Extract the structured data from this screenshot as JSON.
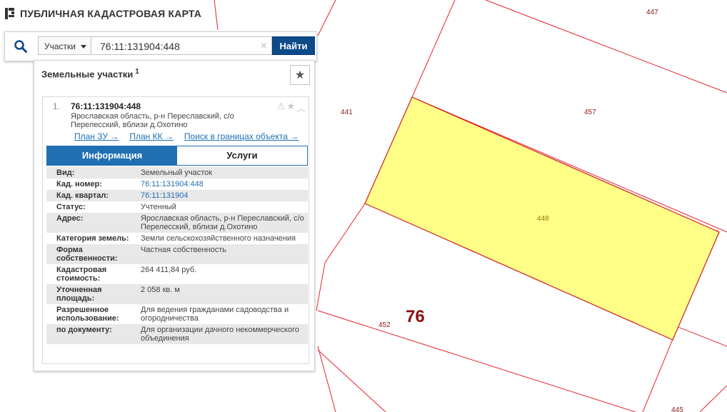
{
  "app": {
    "title": "ПУБЛИЧНАЯ КАДАСТРОВАЯ КАРТА"
  },
  "search": {
    "type_selected": "Участки",
    "query": "76:11:131904:448",
    "find_label": "Найти"
  },
  "results": {
    "header": "Земельные участки",
    "count": "1",
    "item": {
      "index": "1.",
      "cad_number": "76:11:131904:448",
      "address": "Ярославская область, р-н Переславский, с/о Перелесский, вблизи д.Охотино",
      "links": {
        "plan_zu": "План ЗУ →",
        "plan_kk": "План КК →",
        "search_bounds": "Поиск в границах объекта →"
      },
      "tabs": {
        "info": "Информация",
        "services": "Услуги"
      },
      "fields": [
        {
          "label": "Вид:",
          "value": "Земельный участок"
        },
        {
          "label": "Кад. номер:",
          "value": "76:11:131904:448"
        },
        {
          "label": "Кад. квартал:",
          "value": "76:11:131904"
        },
        {
          "label": "Статус:",
          "value": "Учтенный"
        },
        {
          "label": "Адрес:",
          "value": "Ярославская область, р-н Переславский, с/о Перелесский, вблизи д.Охотино"
        },
        {
          "label": "Категория земель:",
          "value": "Земли сельскохозяйственного назначения"
        },
        {
          "label": "Форма собственности:",
          "value": "Частная собственность"
        },
        {
          "label": "Кадастровая стоимость:",
          "value": "264 411,84 руб."
        },
        {
          "label": "Уточненная площадь:",
          "value": "2 058 кв. м"
        },
        {
          "label": "Разрешенное использование:",
          "value": "Для ведения гражданами садоводства и огородничества"
        },
        {
          "label": "по документу:",
          "value": "Для организации дачного некоммерческого объединения"
        }
      ]
    }
  },
  "map": {
    "quarter_number": "76",
    "parcel_labels": {
      "p447": "447",
      "p441": "441",
      "p457": "457",
      "p448": "448",
      "p452": "452",
      "p445": "445"
    },
    "colors": {
      "boundary": "#e8212b",
      "selected_fill": "#ffff88",
      "selected_stroke": "#d11a1a",
      "label": "#8b1a1a"
    }
  },
  "icons": {
    "search": "search-icon",
    "clear": "close-icon",
    "favorite": "star-icon",
    "warning": "warning-icon",
    "collapse": "chevron-up-icon",
    "logo": "pkk-logo"
  }
}
